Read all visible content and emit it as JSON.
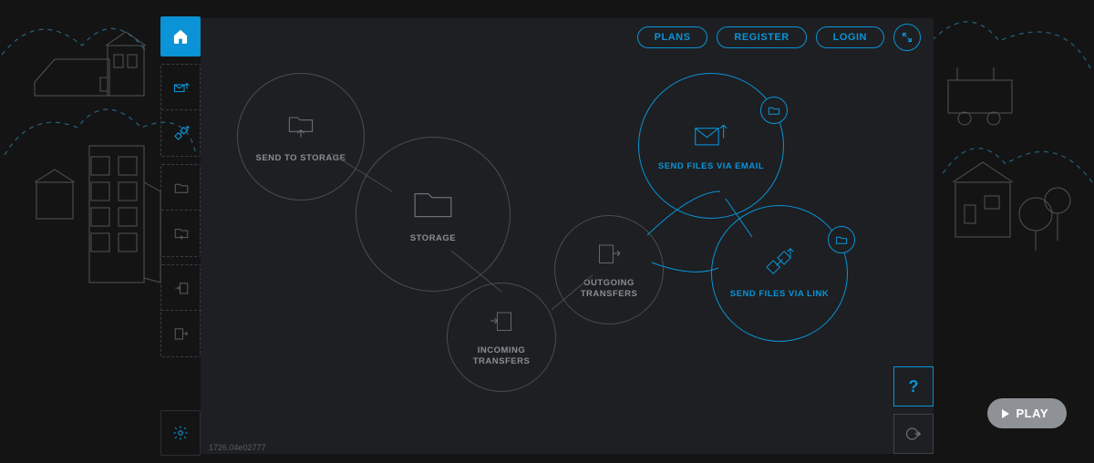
{
  "topbar": {
    "plans": "PLANS",
    "register": "REGISTER",
    "login": "LOGIN"
  },
  "icons": {
    "home": "home-icon",
    "envelope_arrow": "mail-up-icon",
    "link_arrow": "link-up-icon",
    "folder": "folder-icon",
    "folder_in": "folder-in-icon",
    "arrow_in": "arrow-in-icon",
    "arrow_out": "arrow-out-icon",
    "gear": "gear-icon",
    "expand": "expand-icon",
    "help": "?",
    "exit": "exit-icon"
  },
  "bubbles": {
    "send_to_storage": "SEND TO STORAGE",
    "storage": "STORAGE",
    "outgoing": "OUTGOING\nTRANSFERS",
    "incoming": "INCOMING\nTRANSFERS",
    "via_email": "SEND FILES VIA EMAIL",
    "via_link": "SEND FILES VIA LINK"
  },
  "footer": {
    "version": "1726.04e02777",
    "play": "PLAY"
  }
}
